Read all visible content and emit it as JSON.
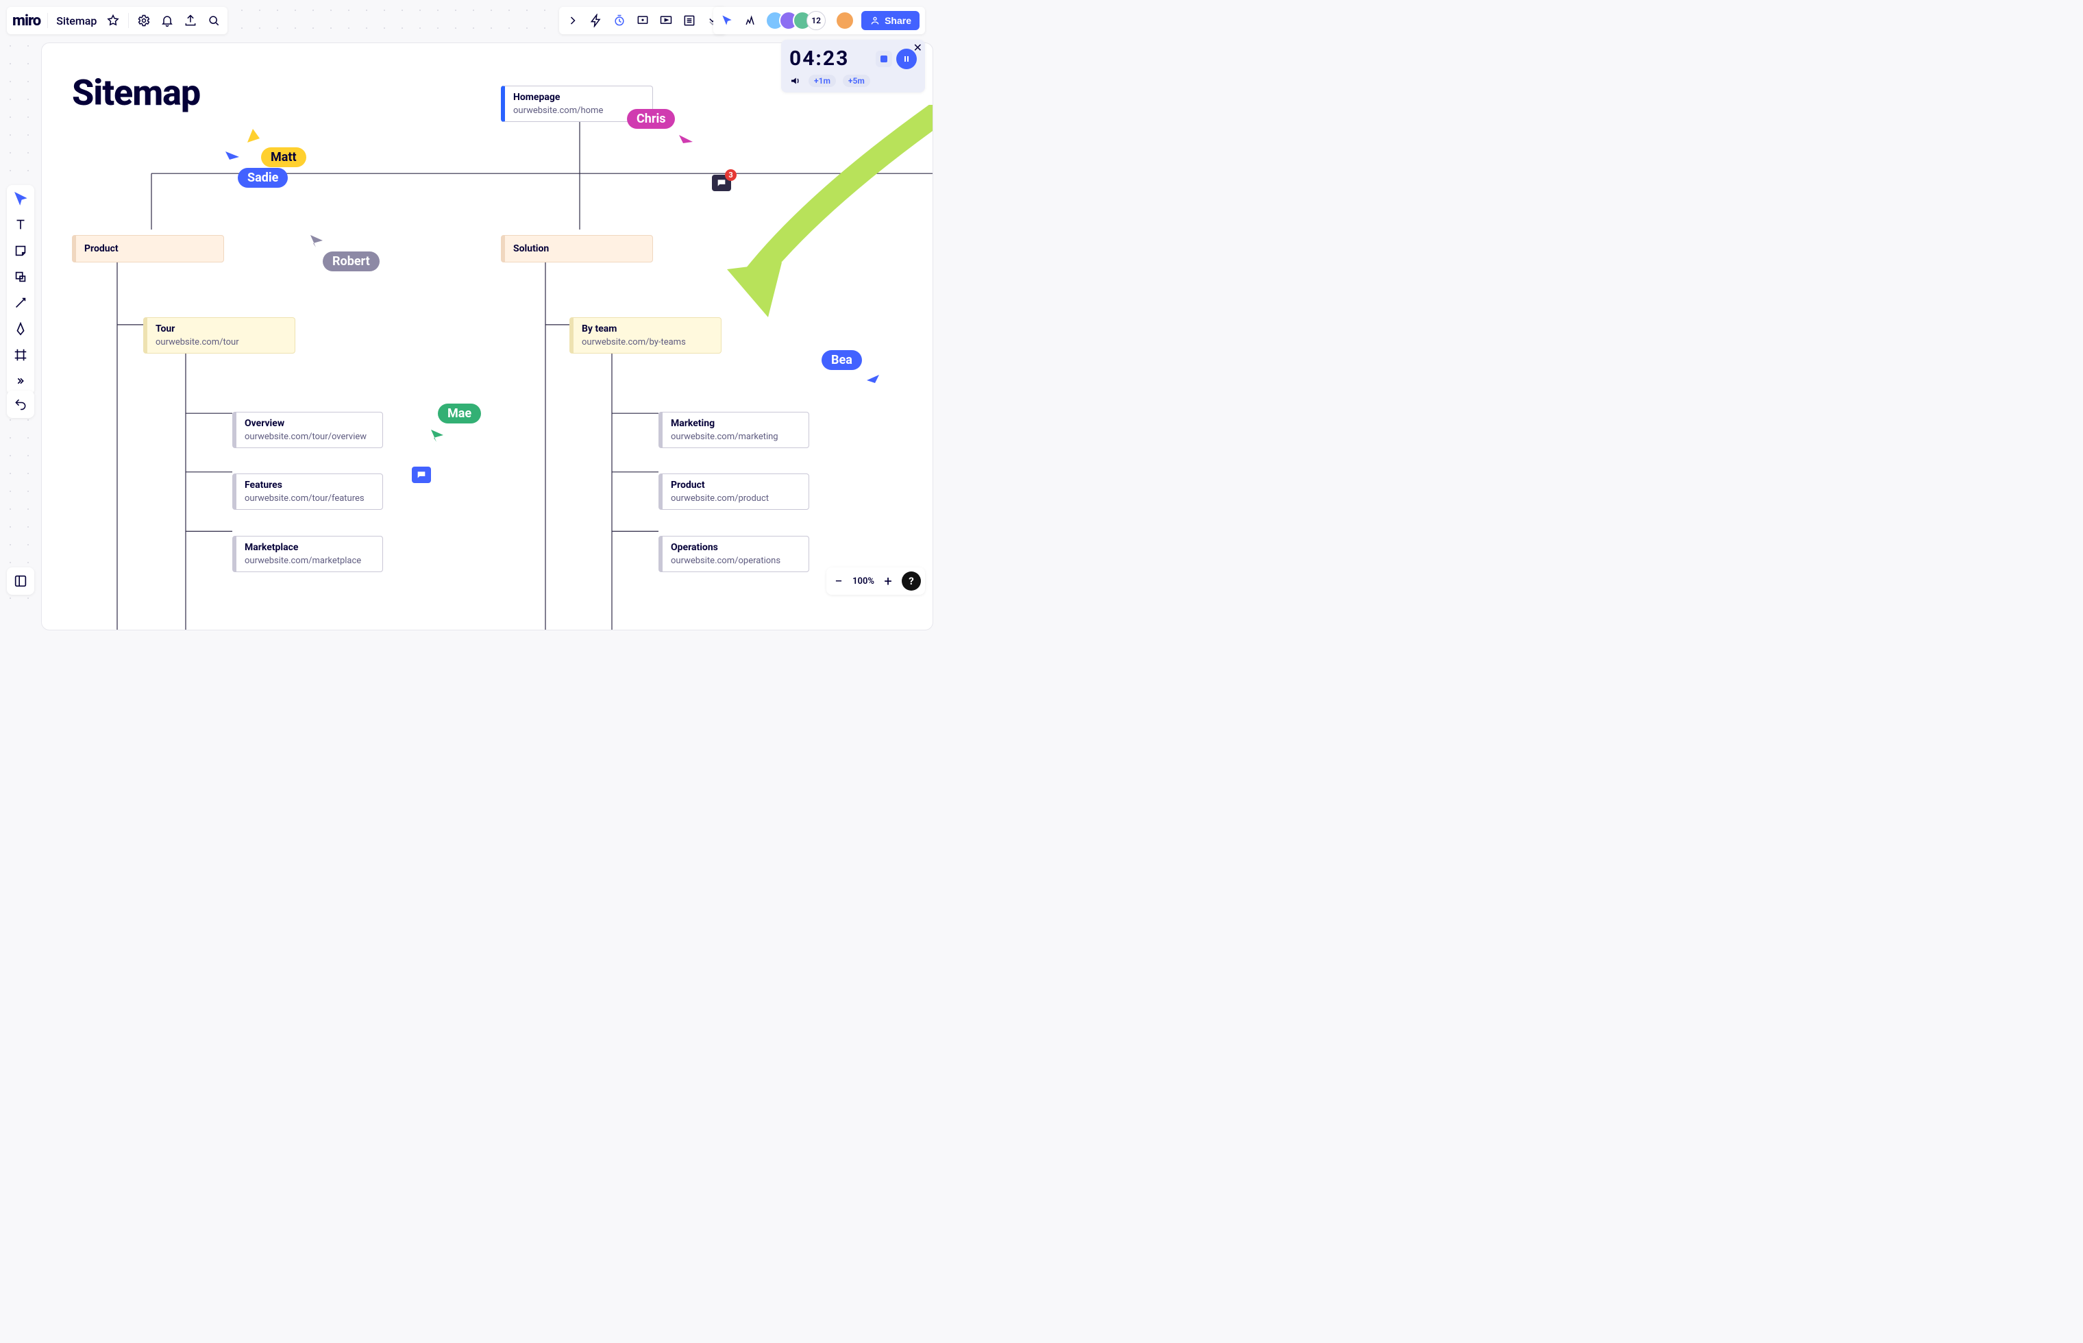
{
  "app": {
    "logo_text": "miro",
    "board_name": "Sitemap"
  },
  "share": {
    "label": "Share"
  },
  "avatars": {
    "count_label": "12",
    "colors": [
      "#7cc4ff",
      "#8c6ef2",
      "#5fbf97",
      "#f4a55a"
    ]
  },
  "timer": {
    "time": "04:23",
    "plus1": "+1m",
    "plus5": "+5m"
  },
  "zoom": {
    "value": "100%"
  },
  "canvas": {
    "title": "Sitemap",
    "homepage": {
      "title": "Homepage",
      "url": "ourwebsite.com/home"
    },
    "product": {
      "title": "Product"
    },
    "solution": {
      "title": "Solution"
    },
    "tour": {
      "title": "Tour",
      "url": "ourwebsite.com/tour"
    },
    "byteam": {
      "title": "By team",
      "url": "ourwebsite.com/by-teams"
    },
    "overview": {
      "title": "Overview",
      "url": "ourwebsite.com/tour/overview"
    },
    "features": {
      "title": "Features",
      "url": "ourwebsite.com/tour/features"
    },
    "marketplace": {
      "title": "Marketplace",
      "url": "ourwebsite.com/marketplace"
    },
    "marketing": {
      "title": "Marketing",
      "url": "ourwebsite.com/marketing"
    },
    "product2": {
      "title": "Product",
      "url": "ourwebsite.com/product"
    },
    "operations": {
      "title": "Operations",
      "url": "ourwebsite.com/operations"
    }
  },
  "collaborators": {
    "matt": {
      "name": "Matt",
      "color": "#ffd02f",
      "text": "#050038"
    },
    "sadie": {
      "name": "Sadie",
      "color": "#4262ff",
      "text": "#ffffff"
    },
    "robert": {
      "name": "Robert",
      "color": "#8d89a5",
      "text": "#ffffff"
    },
    "chris": {
      "name": "Chris",
      "color": "#d03bb0",
      "text": "#ffffff"
    },
    "mae": {
      "name": "Mae",
      "color": "#33b074",
      "text": "#ffffff"
    },
    "bea": {
      "name": "Bea",
      "color": "#4262ff",
      "text": "#ffffff"
    }
  },
  "comments": {
    "thread_badge": "3"
  }
}
